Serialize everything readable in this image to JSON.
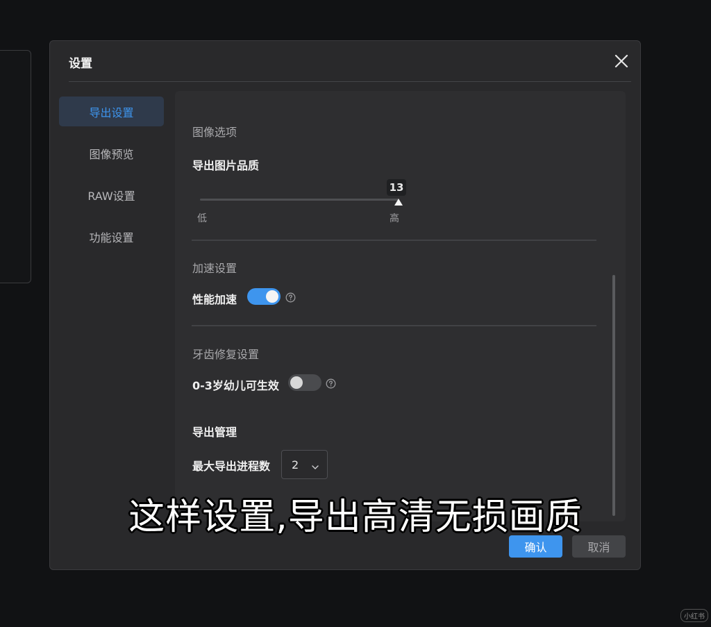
{
  "dialog": {
    "title": "设置",
    "close_icon": "close-icon"
  },
  "nav": {
    "items": [
      {
        "label": "导出设置",
        "active": true
      },
      {
        "label": "图像预览",
        "active": false
      },
      {
        "label": "RAW设置",
        "active": false
      },
      {
        "label": "功能设置",
        "active": false
      }
    ]
  },
  "image_options": {
    "section": "图像选项",
    "quality_label": "导出图片品质",
    "quality_value": "13",
    "slider_fraction": 1.0,
    "low_label": "低",
    "high_label": "高"
  },
  "acceleration": {
    "section": "加速设置",
    "toggle_label": "性能加速",
    "enabled": true,
    "help_icon": "question-circle-icon"
  },
  "teeth": {
    "section": "牙齿修复设置",
    "toggle_label": "0-3岁幼儿可生效",
    "enabled": false,
    "help_icon": "question-circle-icon"
  },
  "export_mgmt": {
    "section": "导出管理",
    "proc_label": "最大导出进程数",
    "proc_value": "2",
    "chevron_icon": "chevron-down-icon"
  },
  "footer": {
    "confirm": "确认",
    "cancel": "取消"
  },
  "caption": "这样设置,导出高清无损画质",
  "watermark": "小红书",
  "colors": {
    "accent": "#3e95ee",
    "dialog_bg": "#29292b",
    "page_bg": "#111214"
  }
}
